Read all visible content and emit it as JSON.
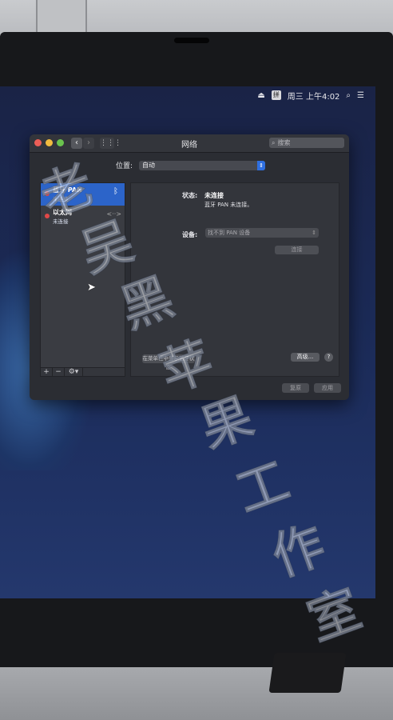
{
  "menubar": {
    "input_indicator": "拼",
    "clock": "周三 上午4:02"
  },
  "window": {
    "title": "网络",
    "search_placeholder": "搜索",
    "location_label": "位置:",
    "location_value": "自动"
  },
  "services": [
    {
      "name": "蓝牙 PAN",
      "status": "未连接",
      "selected": true
    },
    {
      "name": "以太网",
      "status": "未连接",
      "selected": false
    }
  ],
  "sidebar_footer": {
    "add": "+",
    "remove": "−",
    "gear": "⚙▾"
  },
  "detail": {
    "status_label": "状态:",
    "status_value": "未连接",
    "status_desc": "蓝牙 PAN 未连接。",
    "device_label": "设备:",
    "device_value": "找不到 PAN 设备",
    "connect_button": "连接",
    "show_menubar_button": "在菜单栏中显示蓝牙状态",
    "advanced_button": "高级...",
    "help_button": "?"
  },
  "footer": {
    "revert_button": "复原",
    "apply_button": "应用"
  },
  "watermark": [
    "老",
    "吴",
    "黑",
    "苹",
    "果",
    "工",
    "作",
    "室"
  ],
  "colors": {
    "selection": "#2c64c9",
    "status_dot": "#e04848",
    "close": "#ec5e57",
    "minimize": "#f1bb3f",
    "zoom": "#6ac34e"
  }
}
